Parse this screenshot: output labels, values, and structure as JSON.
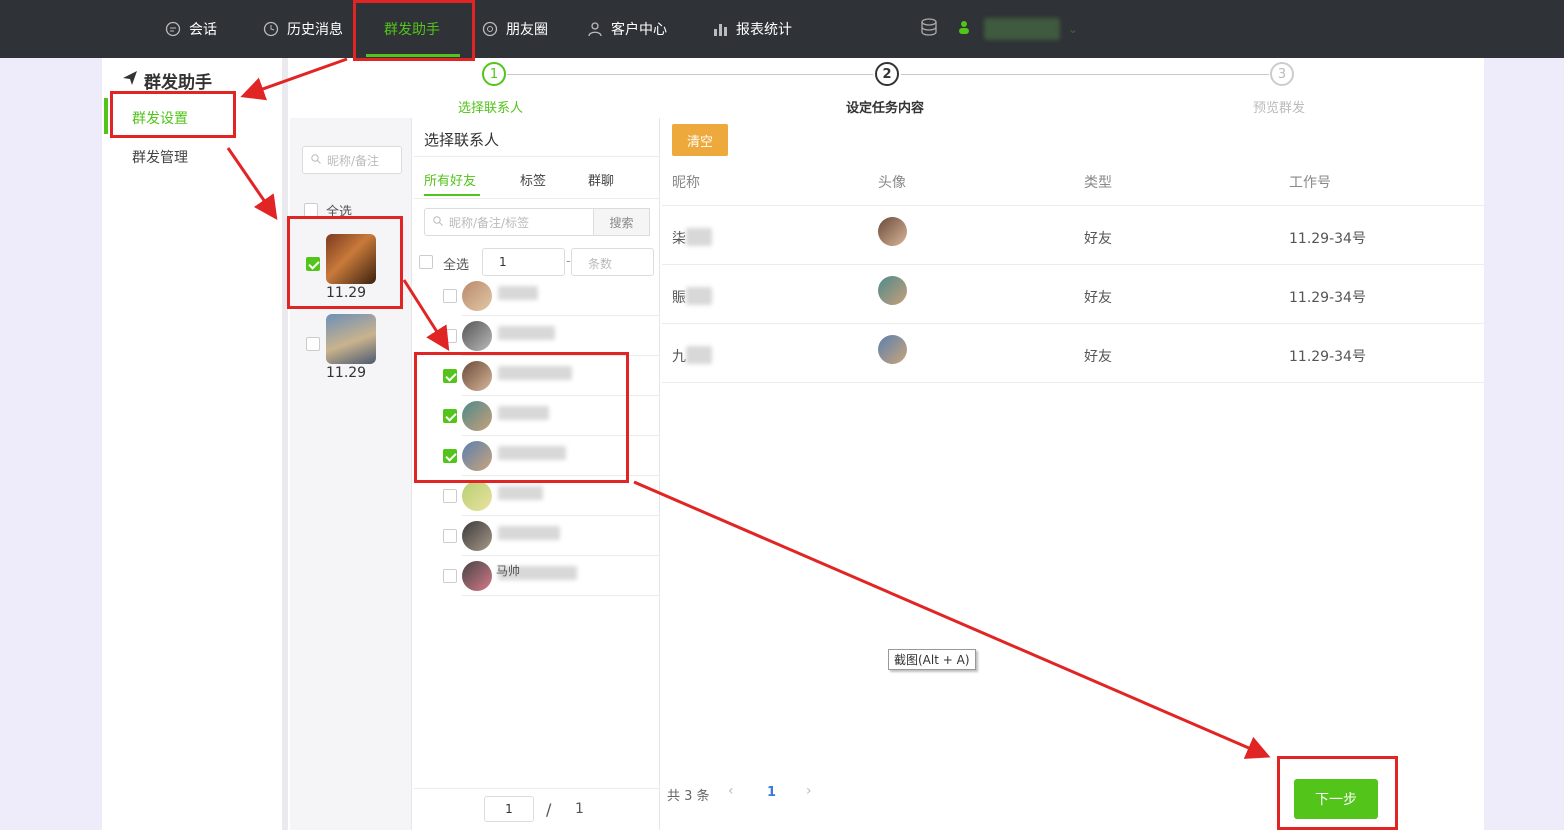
{
  "nav": {
    "items": [
      {
        "label": "会话",
        "icon": "chat-icon"
      },
      {
        "label": "历史消息",
        "icon": "clock-icon"
      },
      {
        "label": "群发助手",
        "icon": ""
      },
      {
        "label": "朋友圈",
        "icon": "aperture-icon"
      },
      {
        "label": "客户中心",
        "icon": "person-icon"
      },
      {
        "label": "报表统计",
        "icon": "bar-chart-icon"
      }
    ],
    "active": "群发助手"
  },
  "sidebar": {
    "title": "群发助手",
    "items": [
      {
        "label": "群发设置",
        "active": true
      },
      {
        "label": "群发管理",
        "active": false
      }
    ]
  },
  "steps": [
    {
      "num": "1",
      "label": "选择联系人",
      "state": "done"
    },
    {
      "num": "2",
      "label": "设定任务内容",
      "state": "current"
    },
    {
      "num": "3",
      "label": "预览群发",
      "state": "pending"
    }
  ],
  "accounts": {
    "search_placeholder": "昵称/备注",
    "select_all": "全选",
    "items": [
      {
        "name": "11.29",
        "checked": true
      },
      {
        "name": "11.29",
        "checked": false
      }
    ]
  },
  "contacts": {
    "title": "选择联系人",
    "tabs": [
      "所有好友",
      "标签",
      "群聊"
    ],
    "search_placeholder": "昵称/备注/标签",
    "search_button": "搜索",
    "select_all": "全选",
    "range_start": "1",
    "range_sep": "-",
    "range_end_placeholder": "条数",
    "checked": [
      false,
      false,
      true,
      true,
      true,
      false,
      false,
      false
    ],
    "partial_names": {
      "row8": "马帅"
    },
    "page": "1",
    "page_sep": "/",
    "page_total": "1"
  },
  "selected": {
    "clear_button": "清空",
    "headers": [
      "昵称",
      "头像",
      "类型",
      "工作号"
    ],
    "rows": [
      {
        "nick": "柒",
        "type": "好友",
        "account": "11.29-34号"
      },
      {
        "nick": "賑",
        "type": "好友",
        "account": "11.29-34号"
      },
      {
        "nick": "九",
        "type": "好友",
        "account": "11.29-34号"
      }
    ],
    "total": "共 3 条",
    "page": "1",
    "tooltip": "截图(Alt + A)",
    "next_button": "下一步"
  },
  "colors": {
    "accent": "#52c41a",
    "orange": "#eda93b",
    "annotation": "#e12424",
    "topbar": "#2f3236"
  }
}
